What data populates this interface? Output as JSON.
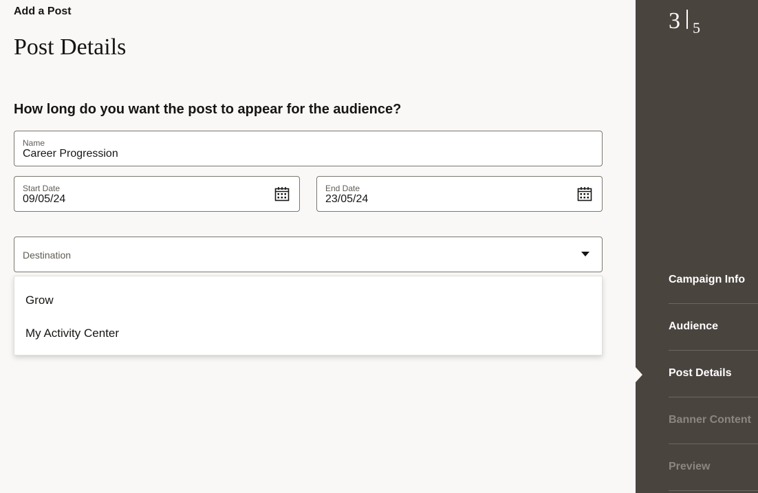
{
  "breadcrumb": "Add a Post",
  "page_title": "Post Details",
  "question": "How long do you want the post to appear for the audience?",
  "form": {
    "name": {
      "label": "Name",
      "value": "Career Progression"
    },
    "start_date": {
      "label": "Start Date",
      "value": "09/05/24"
    },
    "end_date": {
      "label": "End Date",
      "value": "23/05/24"
    },
    "destination": {
      "label": "Destination",
      "options": [
        "Grow",
        "My Activity Center"
      ]
    }
  },
  "progress": {
    "current": "3",
    "total": "5"
  },
  "steps": [
    {
      "label": "Campaign Info",
      "state": "done"
    },
    {
      "label": "Audience",
      "state": "done"
    },
    {
      "label": "Post Details",
      "state": "active"
    },
    {
      "label": "Banner Content",
      "state": "future"
    },
    {
      "label": "Preview",
      "state": "future"
    }
  ],
  "colors": {
    "sidebar_bg": "#4a443f",
    "page_bg": "#f9f8f6",
    "step_inactive": "#8c8681"
  },
  "icons": {
    "calendar": "calendar-icon",
    "dropdown": "chevron-down-icon",
    "current_step": "step-marker-icon"
  }
}
